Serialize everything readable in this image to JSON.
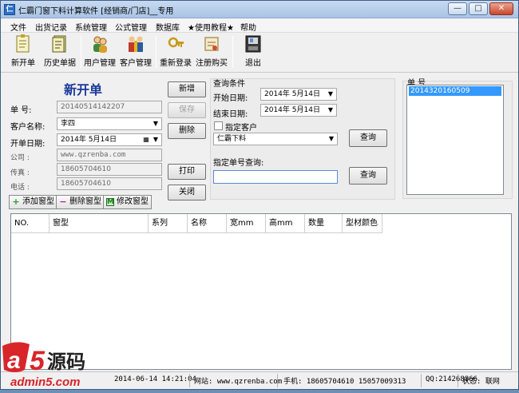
{
  "window": {
    "title": "仁霸门窗下料计算软件 [经销商/门店]__专用",
    "controls": [
      "—",
      "□",
      "✕"
    ]
  },
  "menu": [
    "文件",
    "出货记录",
    "系统管理",
    "公式管理",
    "数据库",
    "★使用教程★",
    "帮助"
  ],
  "toolbar": {
    "items": [
      {
        "label": "新开单",
        "icon": "new-order-icon"
      },
      {
        "label": "历史单据",
        "icon": "history-icon"
      },
      {
        "label": "用户管理",
        "icon": "users-icon"
      },
      {
        "label": "客户管理",
        "icon": "customers-icon"
      },
      {
        "label": "重新登录",
        "icon": "relogin-icon"
      },
      {
        "label": "注册购买",
        "icon": "register-icon"
      },
      {
        "label": "退出",
        "icon": "exit-icon"
      }
    ]
  },
  "order": {
    "heading": "新开单",
    "number_label": "单  号:",
    "number_value": "20140514142207",
    "customer_label": "客户名称:",
    "customer_value": "李四",
    "date_label": "开单日期:",
    "date_value": "2014年  5月14日",
    "company_label": "公司 :",
    "company_value": "www.qzrenba.com",
    "fax_label": "传真 :",
    "fax_value": "18605704610",
    "phone_label": "电话 :",
    "phone_value": "18605704610"
  },
  "actions": {
    "add": "新增",
    "save": "保存",
    "delete": "删除",
    "print": "打印",
    "close": "关闭"
  },
  "window_type_buttons": {
    "add": "添加窗型",
    "delete": "删除窗型",
    "edit": "修改窗型"
  },
  "query": {
    "group_label": "查询条件",
    "start_label": "开始日期:",
    "start_value": "2014年  5月14日",
    "end_label": "结束日期:",
    "end_value": "2014年  5月14日",
    "customer_check_label": "指定客户",
    "customer_value": "仁霸下料",
    "query_button": "查询",
    "order_no_label": "指定单号查询:",
    "order_no_value": "",
    "query_button2": "查询"
  },
  "order_list": {
    "label": "单  号",
    "items": [
      "2014320160509"
    ]
  },
  "table": {
    "columns": [
      "NO.",
      "窗型",
      "系列",
      "名称",
      "宽mm",
      "高mm",
      "数量",
      "型材颜色"
    ]
  },
  "status": {
    "datetime": "2014-06-14 14:21:04",
    "website": "网站: www.qzrenba.com",
    "phone": "手机: 18605704610 15057009313",
    "qq": "QQ:214268866",
    "state": "状态: 联网"
  },
  "watermark": {
    "brand": "a5源码",
    "url": "admin5.com"
  }
}
